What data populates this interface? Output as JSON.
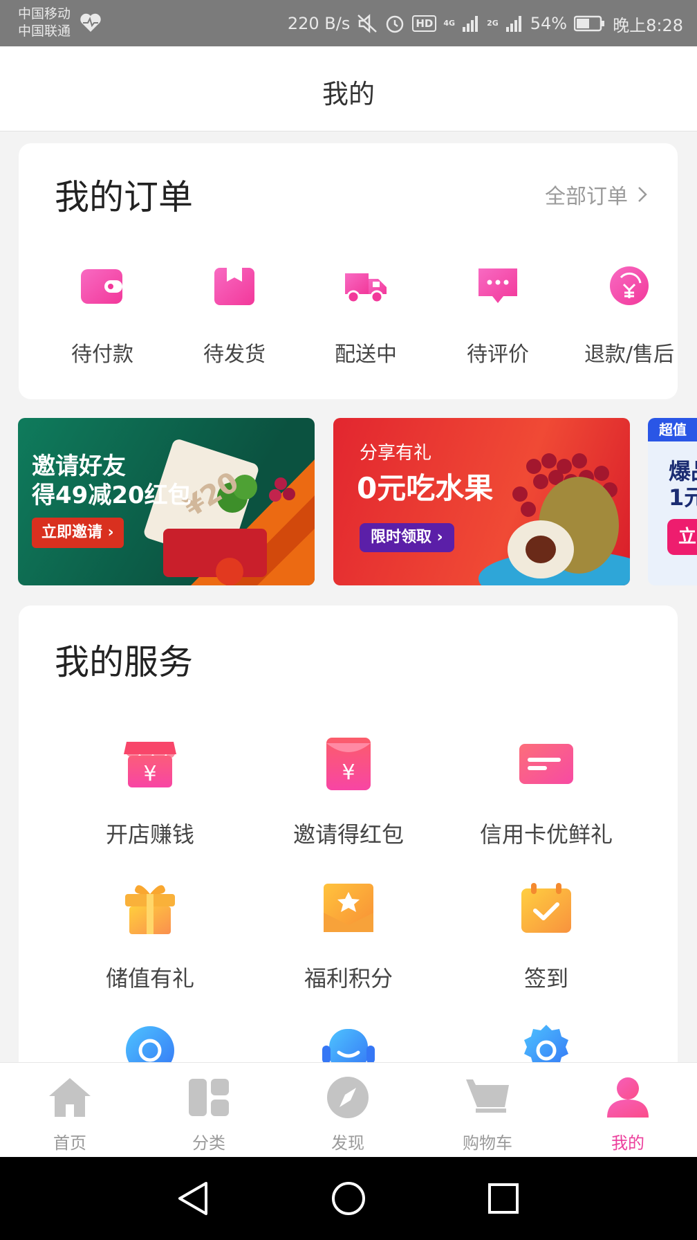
{
  "status_bar": {
    "carrier_1": "中国移动",
    "carrier_2": "中国联通",
    "net_speed": "220 B/s",
    "hd": "HD",
    "net_4g": "4G",
    "net_2g": "2G",
    "battery": "54%",
    "time": "晚上8:28"
  },
  "header": {
    "title": "我的"
  },
  "orders": {
    "title": "我的订单",
    "all_link": "全部订单",
    "items": [
      {
        "label": "待付款",
        "icon": "wallet-icon"
      },
      {
        "label": "待发货",
        "icon": "package-icon"
      },
      {
        "label": "配送中",
        "icon": "delivery-truck-icon"
      },
      {
        "label": "待评价",
        "icon": "chat-bubble-icon"
      },
      {
        "label": "退款/售后",
        "icon": "refund-icon"
      }
    ]
  },
  "banners": [
    {
      "line1": "邀请好友",
      "line2": "得49减20红包",
      "button": "立即邀请",
      "coupon": "¥20"
    },
    {
      "line0": "分享有礼",
      "line1": "0元吃水果",
      "button": "限时领取"
    },
    {
      "tag": "超值",
      "line1": "爆品",
      "line2": "1元",
      "button": "立"
    }
  ],
  "services": {
    "title": "我的服务",
    "items": [
      {
        "label": "开店赚钱",
        "icon": "shop-icon"
      },
      {
        "label": "邀请得红包",
        "icon": "red-envelope-icon"
      },
      {
        "label": "信用卡优鲜礼",
        "icon": "credit-card-icon"
      },
      {
        "label": "储值有礼",
        "icon": "gift-icon"
      },
      {
        "label": "福利积分",
        "icon": "points-envelope-icon"
      },
      {
        "label": "签到",
        "icon": "calendar-check-icon"
      },
      {
        "label": "",
        "icon": "circle-icon"
      },
      {
        "label": "",
        "icon": "customer-service-icon"
      },
      {
        "label": "",
        "icon": "settings-icon"
      }
    ]
  },
  "tabbar": {
    "items": [
      {
        "label": "首页",
        "icon": "home-icon"
      },
      {
        "label": "分类",
        "icon": "category-icon"
      },
      {
        "label": "发现",
        "icon": "compass-icon"
      },
      {
        "label": "购物车",
        "icon": "cart-icon"
      },
      {
        "label": "我的",
        "icon": "user-icon"
      }
    ],
    "active_index": 4
  },
  "colors": {
    "accent": "#ec3f9c",
    "accent_gradient_start": "#f65fb9",
    "accent_gradient_end": "#fb4d8a",
    "status_bar_bg": "#7b7b7b",
    "page_bg": "#f3f3f3"
  }
}
